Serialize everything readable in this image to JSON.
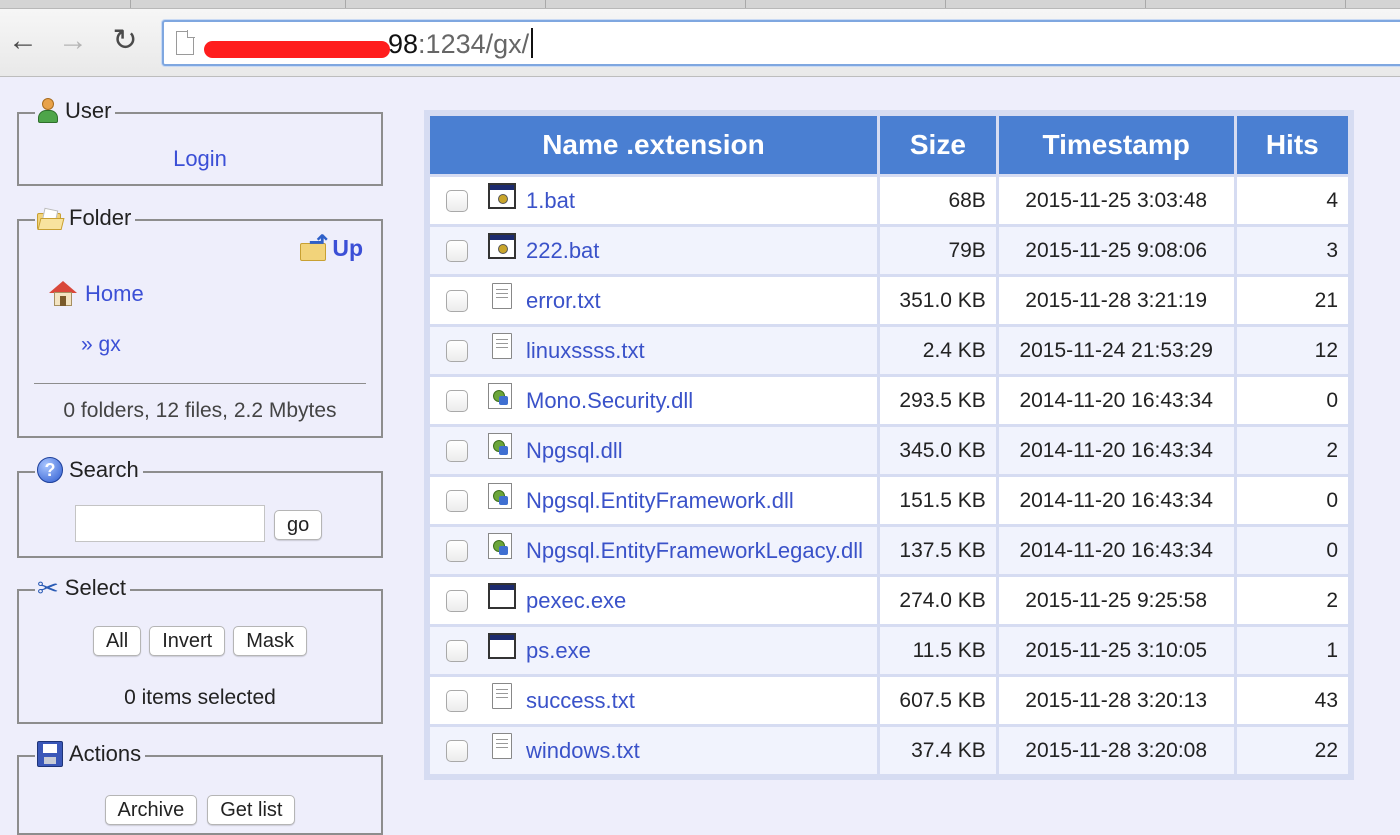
{
  "browser": {
    "url_host_suffix": "98",
    "url_rest": ":1234/gx/"
  },
  "sidebar": {
    "user": {
      "title": "User",
      "login_label": "Login"
    },
    "folder": {
      "title": "Folder",
      "up_label": "Up",
      "home_label": "Home",
      "current_label": "» gx",
      "summary": "0 folders, 12 files, 2.2 Mbytes"
    },
    "search": {
      "title": "Search",
      "input_value": "",
      "go_label": "go"
    },
    "select": {
      "title": "Select",
      "all_label": "All",
      "invert_label": "Invert",
      "mask_label": "Mask",
      "status": "0 items selected"
    },
    "actions": {
      "title": "Actions",
      "archive_label": "Archive",
      "getlist_label": "Get list"
    }
  },
  "table": {
    "headers": {
      "name": "Name .extension",
      "size": "Size",
      "timestamp": "Timestamp",
      "hits": "Hits"
    },
    "rows": [
      {
        "name": "1.bat",
        "icon": "batch-file-icon",
        "size": "68B",
        "timestamp": "2015-11-25 3:03:48",
        "hits": "4"
      },
      {
        "name": "222.bat",
        "icon": "batch-file-icon",
        "size": "79B",
        "timestamp": "2015-11-25 9:08:06",
        "hits": "3"
      },
      {
        "name": "error.txt",
        "icon": "text-file-icon",
        "size": "351.0 KB",
        "timestamp": "2015-11-28 3:21:19",
        "hits": "21"
      },
      {
        "name": "linuxssss.txt",
        "icon": "text-file-icon",
        "size": "2.4 KB",
        "timestamp": "2015-11-24 21:53:29",
        "hits": "12"
      },
      {
        "name": "Mono.Security.dll",
        "icon": "dll-file-icon",
        "size": "293.5 KB",
        "timestamp": "2014-11-20 16:43:34",
        "hits": "0"
      },
      {
        "name": "Npgsql.dll",
        "icon": "dll-file-icon",
        "size": "345.0 KB",
        "timestamp": "2014-11-20 16:43:34",
        "hits": "2"
      },
      {
        "name": "Npgsql.EntityFramework.dll",
        "icon": "dll-file-icon",
        "size": "151.5 KB",
        "timestamp": "2014-11-20 16:43:34",
        "hits": "0"
      },
      {
        "name": "Npgsql.EntityFrameworkLegacy.dll",
        "icon": "dll-file-icon",
        "size": "137.5 KB",
        "timestamp": "2014-11-20 16:43:34",
        "hits": "0"
      },
      {
        "name": "pexec.exe",
        "icon": "exe-file-icon",
        "size": "274.0 KB",
        "timestamp": "2015-11-25 9:25:58",
        "hits": "2"
      },
      {
        "name": "ps.exe",
        "icon": "exe-file-icon",
        "size": "11.5 KB",
        "timestamp": "2015-11-25 3:10:05",
        "hits": "1"
      },
      {
        "name": "success.txt",
        "icon": "text-file-icon",
        "size": "607.5 KB",
        "timestamp": "2015-11-28 3:20:13",
        "hits": "43"
      },
      {
        "name": "windows.txt",
        "icon": "text-file-icon",
        "size": "37.4 KB",
        "timestamp": "2015-11-28 3:20:08",
        "hits": "22"
      }
    ]
  }
}
